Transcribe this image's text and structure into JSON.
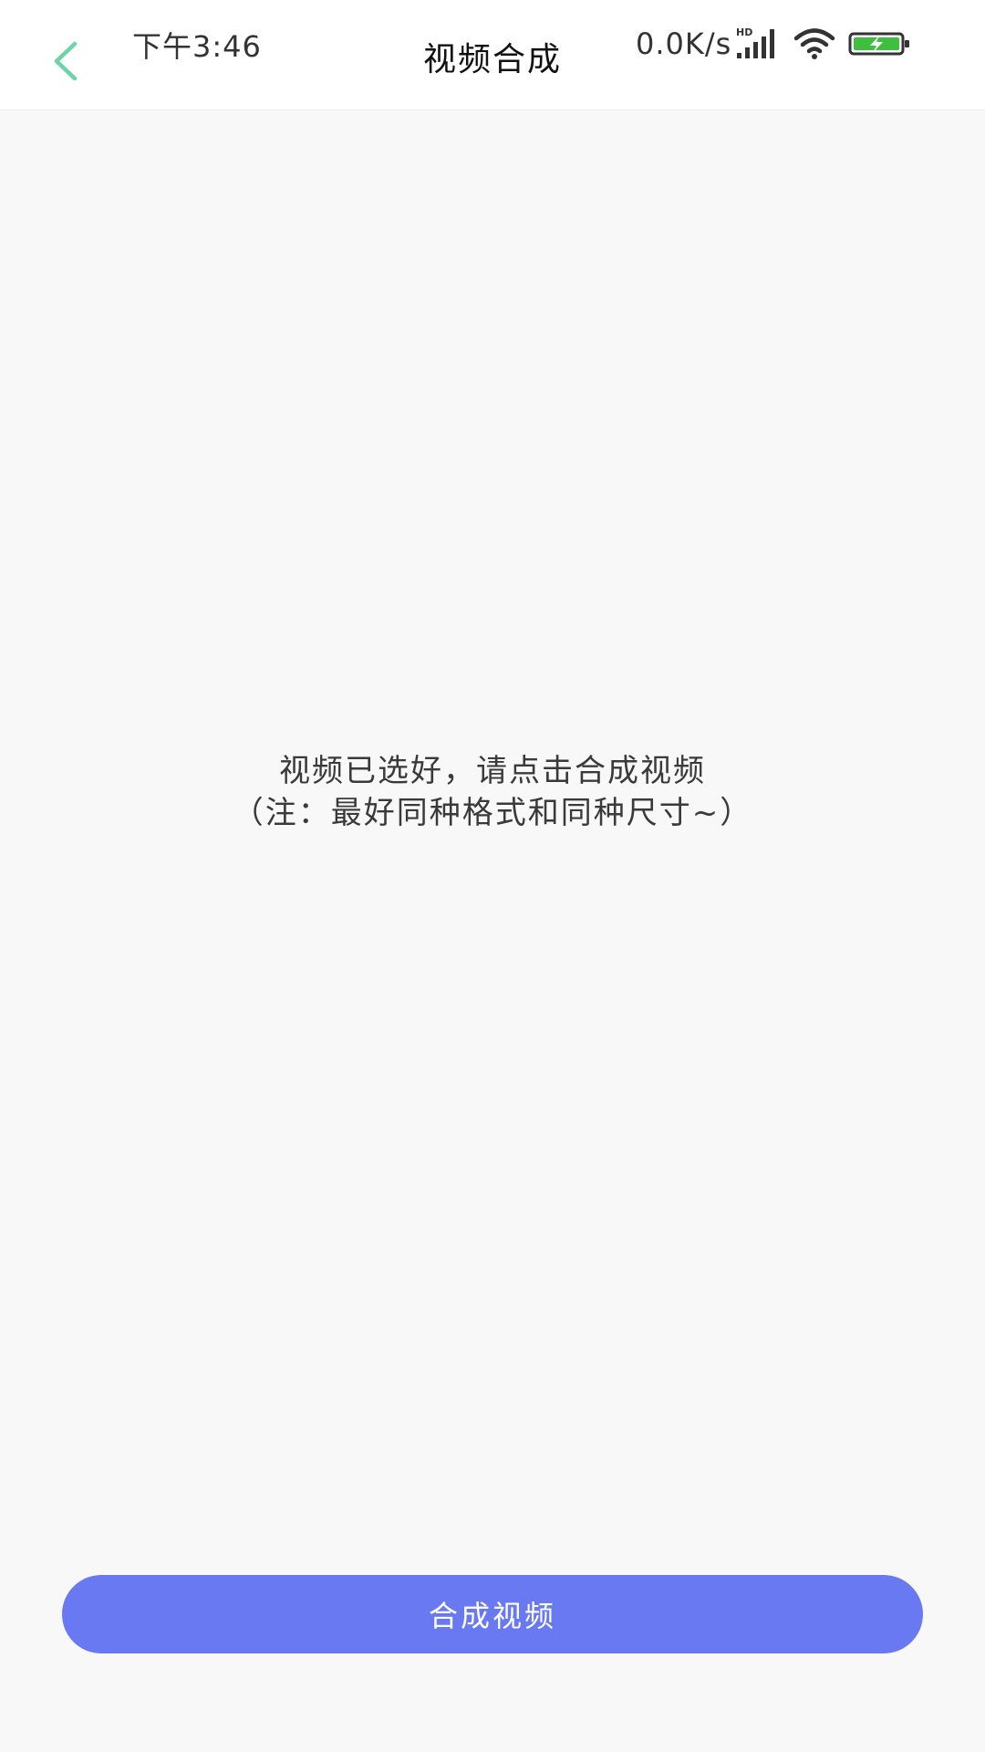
{
  "status_bar": {
    "time": "下午3:46",
    "net_speed": "0.0K/s",
    "signal_badge": "HD",
    "icons": [
      "signal-icon",
      "wifi-icon",
      "battery-charging-icon"
    ],
    "battery_color": "#3fbf3f"
  },
  "header": {
    "title": "视频合成",
    "back_icon": "chevron-left-icon",
    "accent_color": "#6ed3a5"
  },
  "notice": {
    "line1": "视频已选好，请点击合成视频",
    "line2": "（注：最好同种格式和同种尺寸~）"
  },
  "actions": {
    "merge_label": "合成视频",
    "merge_color": "#6879f2"
  }
}
